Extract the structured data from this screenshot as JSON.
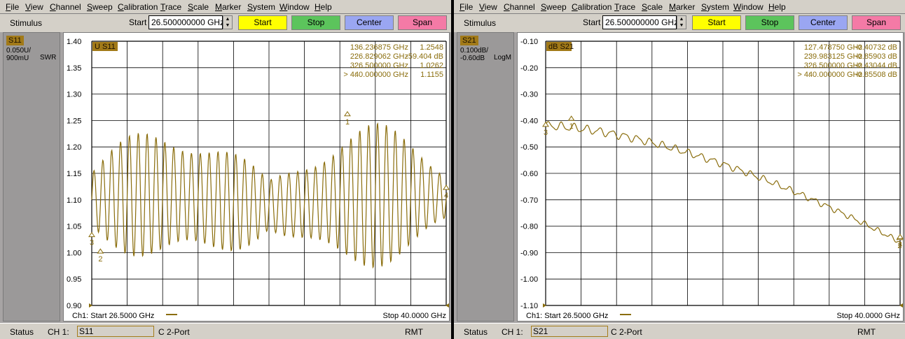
{
  "menu": [
    "File",
    "View",
    "Channel",
    "Sweep",
    "Calibration",
    "Trace",
    "Scale",
    "Marker",
    "System",
    "Window",
    "Help"
  ],
  "toolbar": {
    "stimulus_label": "Stimulus",
    "start_label": "Start",
    "start_value": "26.500000000 GHz",
    "buttons": {
      "start": "Start",
      "stop": "Stop",
      "center": "Center",
      "span": "Span"
    }
  },
  "colors": {
    "trace": "#8a6d0c",
    "btn_start": "#ffff00",
    "btn_stop": "#5cc45c",
    "btn_center": "#9aa6f2",
    "btn_span": "#f47aa6",
    "trace_tag": "#a27a18"
  },
  "panels": [
    {
      "trace_name": "S11",
      "scale_line1": "0.050U/",
      "scale_line2": "900mU",
      "format": "SWR",
      "chart_title": "U S11",
      "ch_label": "Ch1: Start  26.5000 GHz",
      "stop_label": "Stop  40.0000 GHz",
      "markers": [
        {
          "label": "1:",
          "freq": "36.236875 GHz",
          "value": "1.2548"
        },
        {
          "label": "2:",
          "freq": "26.829062 GHz",
          "value": "-59.404 dB"
        },
        {
          "label": "3:",
          "freq": "26.500000 GHz",
          "value": "1.0262"
        },
        {
          "label": "> 4:",
          "freq": "40.000000 GHz",
          "value": "1.1155"
        }
      ],
      "marker_points": [
        {
          "id": "1",
          "x": 36.2369,
          "y": 1.2548
        },
        {
          "id": "2",
          "x": 26.8291,
          "y": 0.995
        },
        {
          "id": "3",
          "x": 26.5,
          "y": 1.0262
        },
        {
          "id": "4",
          "x": 40.0,
          "y": 1.1155
        }
      ],
      "status": {
        "label": "Status",
        "channel": "CH 1:",
        "param": "S11",
        "port_info": "C  2-Port",
        "remote": "RMT"
      },
      "chart_data": {
        "type": "line",
        "xlim": [
          26.5,
          40.0
        ],
        "ylim": [
          0.9,
          1.4
        ],
        "yticks": [
          "1.40",
          "1.35",
          "1.30",
          "1.25",
          "1.20",
          "1.15",
          "1.10",
          "1.05",
          "1.00",
          "0.95",
          "0.90"
        ],
        "series": [
          {
            "model": "ripple",
            "base": 1.1,
            "amp_max": 0.14,
            "cycles": 40
          }
        ],
        "grid": true
      }
    },
    {
      "trace_name": "S21",
      "scale_line1": "0.100dB/",
      "scale_line2": "-0.60dB",
      "format": "LogM",
      "chart_title": "dB S21",
      "ch_label": "Ch1: Start  26.5000 GHz",
      "stop_label": "Stop  40.0000 GHz",
      "markers": [
        {
          "label": "1:",
          "freq": "27.478750 GHz",
          "value": "-0.40732 dB"
        },
        {
          "label": "2:",
          "freq": "39.983125 GHz",
          "value": "-0.85903 dB"
        },
        {
          "label": "3:",
          "freq": "26.500000 GHz",
          "value": "-0.43044 dB"
        },
        {
          "label": "> 4:",
          "freq": "40.000000 GHz",
          "value": "-0.85508 dB"
        }
      ],
      "marker_points": [
        {
          "id": "1",
          "x": 27.4788,
          "y": -0.40732
        },
        {
          "id": "2",
          "x": 39.9831,
          "y": -0.85903
        },
        {
          "id": "3",
          "x": 26.5,
          "y": -0.43044
        },
        {
          "id": "4",
          "x": 40.0,
          "y": -0.85508
        }
      ],
      "status": {
        "label": "Status",
        "channel": "CH 1:",
        "param": "S21",
        "port_info": "C  2-Port",
        "remote": "RMT"
      },
      "chart_data": {
        "type": "line",
        "xlim": [
          26.5,
          40.0
        ],
        "ylim": [
          -1.1,
          -0.1
        ],
        "yticks": [
          "-0.10",
          "-0.20",
          "-0.30",
          "-0.40",
          "-0.50",
          "-0.60",
          "-0.70",
          "-0.80",
          "-0.90",
          "-1.00",
          "-1.10"
        ],
        "series": [
          {
            "model": "rolloff",
            "start": -0.42,
            "end": -0.86,
            "ripple": 0.012,
            "cycles": 28
          }
        ],
        "grid": true
      }
    }
  ]
}
